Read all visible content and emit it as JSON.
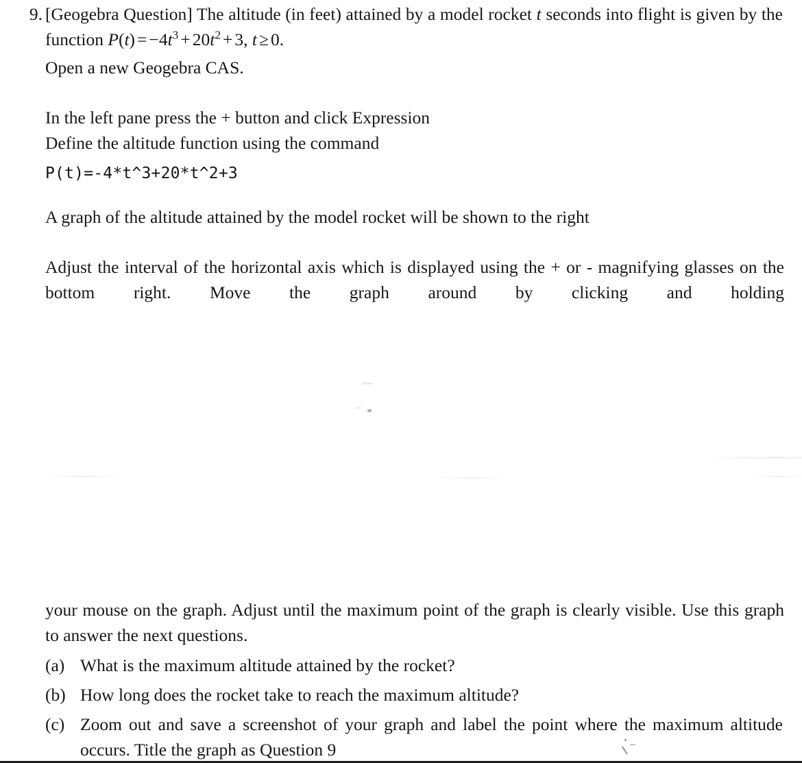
{
  "document": {
    "question_number": "9.",
    "intro": {
      "tag": "[Geogebra Question]",
      "line1_before_math": "[Geogebra Question] The altitude (in feet) attained by a model rocket ",
      "line1_var": "t",
      "line1_after": " seconds into flight is given by the function ",
      "formula": {
        "fn": "P",
        "arg": "t",
        "equals": "=",
        "term1_sign": "−",
        "term1_coef": "4",
        "term1_var": "t",
        "term1_exp": "3",
        "plus1": "+",
        "term2_coef": "20",
        "term2_var": "t",
        "term2_exp": "2",
        "plus2": "+",
        "term3": "3",
        "comma": ", ",
        "domain_var": "t",
        "domain_rel": "≥",
        "domain_val": "0",
        "period": ".",
        "plain": "P(t) = -4t^3 + 20t^2 + 3, t >= 0."
      },
      "open_cas": "Open a new Geogebra CAS."
    },
    "instructions": {
      "step1": "In the left pane press the + button and click Expression",
      "step2": "Define the altitude function using the command",
      "command": "P(t)=-4*t^3+20*t^2+3",
      "graph_note": "A graph of the altitude attained by the model rocket will be shown to the right",
      "adjust": "Adjust the interval of the horizontal axis which is displayed using the + or - magnifying glasses on the bottom right. Move the graph around by clicking and holding your mouse on the graph. Adjust until the maximum point of the graph is clearly visible. Use this graph to answer the next questions.",
      "adjust_part1": "Adjust the interval of the horizontal axis which is displayed using the + or - magnifying glasses on the bottom right. Move the graph around by clicking and holding",
      "adjust_part2": "your mouse on the graph. Adjust until the maximum point of the graph is clearly visible. Use this graph to answer the next questions."
    },
    "subquestions": [
      {
        "marker": "(a)",
        "text": "What is the maximum altitude attained by the rocket?"
      },
      {
        "marker": "(b)",
        "text": "How long does the rocket take to reach the maximum altitude?"
      },
      {
        "marker": "(c)",
        "text": "Zoom out and save a screenshot of your graph and label the point where the maximum altitude occurs.  Title the graph as Question 9"
      }
    ],
    "colors": {
      "background": "#ffffff",
      "text": "#17171a",
      "code_text": "#141416",
      "scan_edge": "#1b1b1f"
    }
  }
}
